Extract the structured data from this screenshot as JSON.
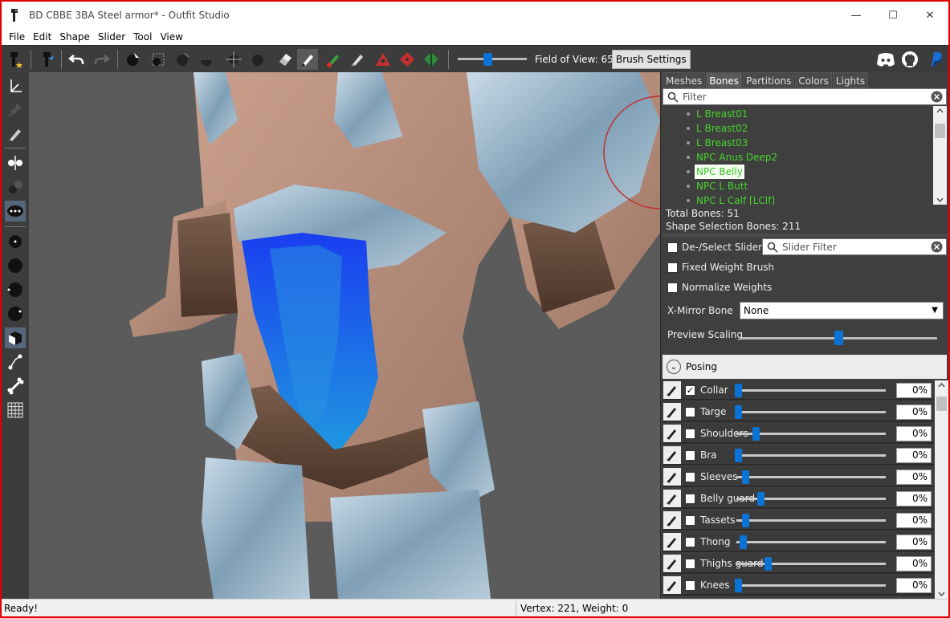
{
  "window": {
    "title": "BD CBBE 3BA Steel armor* - Outfit Studio"
  },
  "window_controls": {
    "minimize": "—",
    "maximize": "☐",
    "close": "✕"
  },
  "menu": [
    "File",
    "Edit",
    "Shape",
    "Slider",
    "Tool",
    "View"
  ],
  "toolbar": {
    "field_of_view_label": "Field of View: 65",
    "field_of_view_level": 0.43,
    "brush_settings": "Brush Settings"
  },
  "tabs": [
    "Meshes",
    "Bones",
    "Partitions",
    "Colors",
    "Lights"
  ],
  "active_tab": "Bones",
  "bone_filter": {
    "placeholder": "Filter"
  },
  "bones": [
    "L Breast01",
    "L Breast02",
    "L Breast03",
    "NPC Anus Deep2",
    "NPC Belly",
    "NPC L Butt",
    "NPC L Calf [LClf]"
  ],
  "selected_bone": "NPC Belly",
  "stats": {
    "total_bones": "Total Bones: 51",
    "shape_selection_bones": "Shape Selection Bones: 211"
  },
  "options": {
    "deselect_sliders": "De-/Select Sliders",
    "slider_filter_placeholder": "Slider Filter",
    "fixed_weight_brush": "Fixed Weight Brush",
    "normalize_weights": "Normalize Weights",
    "x_mirror_label": "X-Mirror Bone",
    "x_mirror_value": "None",
    "preview_scaling_label": "Preview Scaling",
    "preview_scaling_level": 0.5
  },
  "posing": {
    "label": "Posing"
  },
  "sliders": [
    {
      "name": "Collar",
      "checked": true,
      "value": "0%",
      "level": 0.0
    },
    {
      "name": "Targe",
      "checked": false,
      "value": "0%",
      "level": 0.0
    },
    {
      "name": "Shoulders",
      "checked": false,
      "value": "0%",
      "level": 0.12
    },
    {
      "name": "Bra",
      "checked": false,
      "value": "0%",
      "level": 0.0
    },
    {
      "name": "Sleeves",
      "checked": false,
      "value": "0%",
      "level": 0.05
    },
    {
      "name": "Belly guard",
      "checked": false,
      "value": "0%",
      "level": 0.15
    },
    {
      "name": "Tassets",
      "checked": false,
      "value": "0%",
      "level": 0.05
    },
    {
      "name": "Thong",
      "checked": false,
      "value": "0%",
      "level": 0.03
    },
    {
      "name": "Thighs guard",
      "checked": false,
      "value": "0%",
      "level": 0.2
    },
    {
      "name": "Knees",
      "checked": false,
      "value": "0%",
      "level": 0.0
    }
  ],
  "status": {
    "left": "Ready!",
    "right": "Vertex: 221, Weight: 0"
  },
  "colors": {
    "accent": "#0a74d6",
    "bone_text": "#45d62a",
    "panel_bg": "#3f3f3f",
    "viewport_bg": "#5b5b5b",
    "brush_blue": "#1a3ef0"
  },
  "icons": {
    "toolbar": [
      "new-project-icon",
      "open-project-icon",
      "undo-icon",
      "redo-icon",
      "select-icon",
      "transform-icon",
      "inflate-icon",
      "deflate-icon",
      "move-icon",
      "smooth-icon",
      "undiff-icon",
      "mask-icon",
      "weight-paint-icon",
      "color-paint-icon",
      "alpha-paint-icon",
      "collapse-vertex-icon",
      "flip-edge-icon",
      "split-edge-icon",
      "discord-icon",
      "github-icon",
      "paypal-icon"
    ],
    "left": [
      "axis-icon",
      "pin-icon",
      "pencil-icon",
      "mirror-icon",
      "vertices-icon",
      "points-icon",
      "brush-small-icon",
      "brush-medium-icon",
      "brush-large-icon",
      "brush-xlarge-icon",
      "cube-icon",
      "bones-icon",
      "skeleton-icon",
      "grid-icon"
    ]
  }
}
